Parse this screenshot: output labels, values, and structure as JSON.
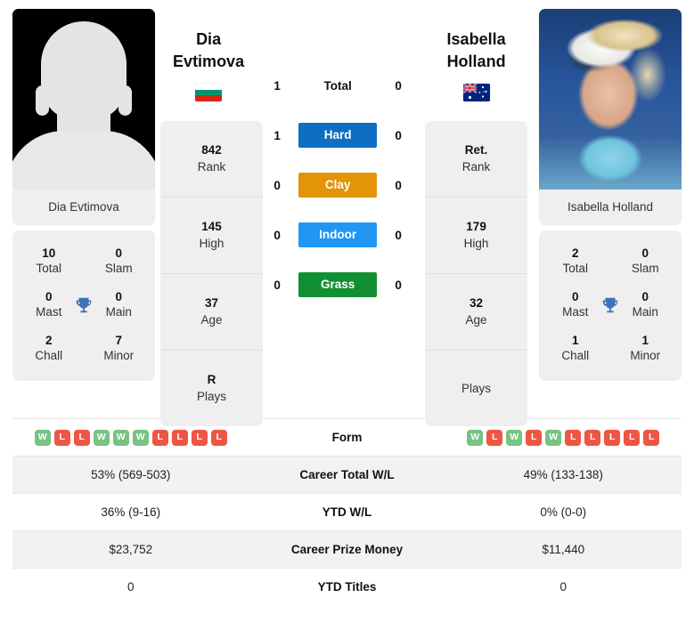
{
  "players": {
    "left": {
      "name": "Dia Evtimova",
      "photo_caption": "Dia Evtimova",
      "country": "Bulgaria",
      "flag": "bulgaria-flag",
      "photo_type": "placeholder-silhouette",
      "info": [
        {
          "value": "842",
          "label": "Rank"
        },
        {
          "value": "145",
          "label": "High"
        },
        {
          "value": "37",
          "label": "Age"
        },
        {
          "value": "R",
          "label": "Plays"
        }
      ],
      "titles": [
        {
          "value": "10",
          "label": "Total"
        },
        {
          "value": "0",
          "label": "Slam"
        },
        {
          "value": "0",
          "label": "Mast"
        },
        {
          "value": "0",
          "label": "Main"
        },
        {
          "value": "2",
          "label": "Chall"
        },
        {
          "value": "7",
          "label": "Minor"
        }
      ]
    },
    "right": {
      "name": "Isabella Holland",
      "photo_caption": "Isabella Holland",
      "country": "Australia",
      "flag": "australia-flag",
      "photo_type": "player-photo",
      "info": [
        {
          "value": "Ret.",
          "label": "Rank"
        },
        {
          "value": "179",
          "label": "High"
        },
        {
          "value": "32",
          "label": "Age"
        },
        {
          "value": "",
          "label": "Plays"
        }
      ],
      "titles": [
        {
          "value": "2",
          "label": "Total"
        },
        {
          "value": "0",
          "label": "Slam"
        },
        {
          "value": "0",
          "label": "Mast"
        },
        {
          "value": "0",
          "label": "Main"
        },
        {
          "value": "1",
          "label": "Chall"
        },
        {
          "value": "1",
          "label": "Minor"
        }
      ]
    }
  },
  "head_to_head": [
    {
      "label": "Total",
      "left": "1",
      "right": "0",
      "badge": false,
      "color": ""
    },
    {
      "label": "Hard",
      "left": "1",
      "right": "0",
      "badge": true,
      "color": "#0d6ec4"
    },
    {
      "label": "Clay",
      "left": "0",
      "right": "0",
      "badge": true,
      "color": "#e39407"
    },
    {
      "label": "Indoor",
      "left": "0",
      "right": "0",
      "badge": true,
      "color": "#2196f3"
    },
    {
      "label": "Grass",
      "left": "0",
      "right": "0",
      "badge": true,
      "color": "#119033"
    }
  ],
  "stats": {
    "form_label": "Form",
    "form_left": [
      "W",
      "L",
      "L",
      "W",
      "W",
      "W",
      "L",
      "L",
      "L",
      "L"
    ],
    "form_right": [
      "W",
      "L",
      "W",
      "L",
      "W",
      "L",
      "L",
      "L",
      "L",
      "L"
    ],
    "rows": [
      {
        "label": "Career Total W/L",
        "left": "53% (569-503)",
        "right": "49% (133-138)"
      },
      {
        "label": "YTD W/L",
        "left": "36% (9-16)",
        "right": "0% (0-0)"
      },
      {
        "label": "Career Prize Money",
        "left": "$23,752",
        "right": "$11,440"
      },
      {
        "label": "YTD Titles",
        "left": "0",
        "right": "0"
      }
    ]
  },
  "colors": {
    "win_badge": "#77c383",
    "loss_badge": "#ef5543",
    "trophy": "#3f72b8",
    "card_bg": "#efefef",
    "row_shade": "#f2f2f2"
  },
  "icons": {
    "trophy": "trophy-icon"
  }
}
